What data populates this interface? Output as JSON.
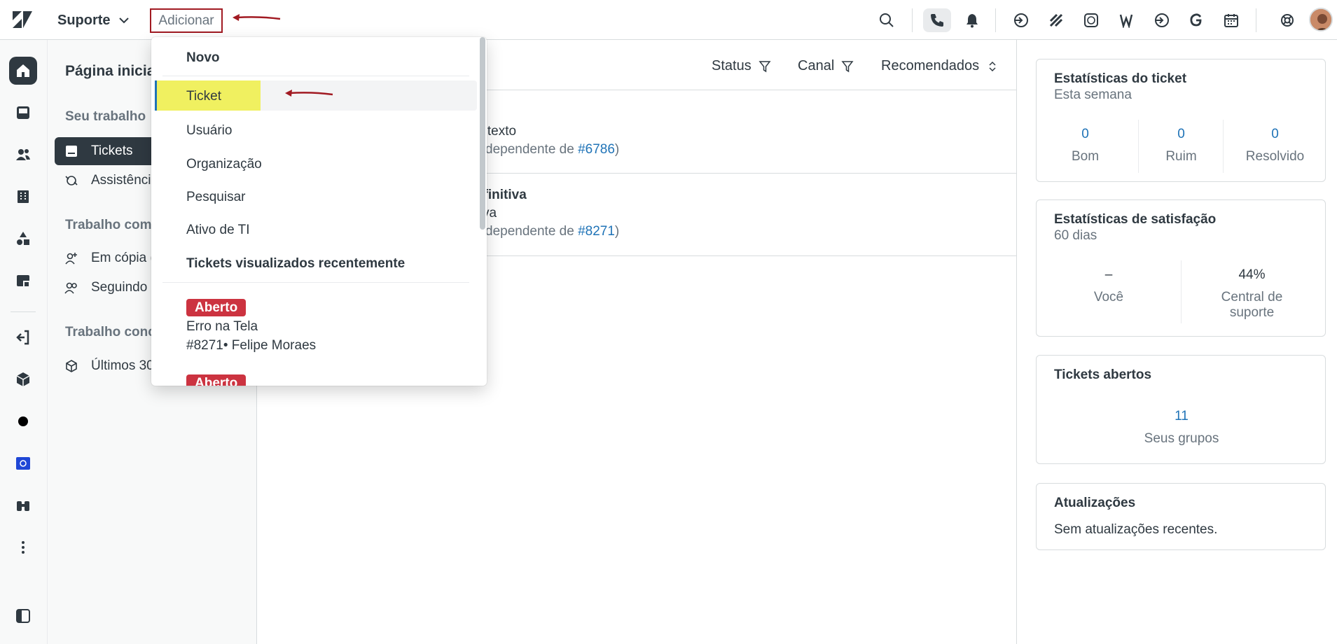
{
  "topbar": {
    "product": "Suporte",
    "add_label": "Adicionar",
    "icons": [
      "search-icon",
      "phone-icon",
      "bell-icon",
      "sign-in-icon",
      "grid-icon",
      "whatsapp-icon",
      "w-icon",
      "sign-in-icon",
      "g-icon",
      "calendar-icon",
      "lifebuoy-icon",
      "avatar"
    ]
  },
  "rail": {
    "icons": [
      "home-icon",
      "inbox-icon",
      "users-icon",
      "building-icon",
      "shapes-icon",
      "report-icon",
      "exit-icon",
      "cube-icon",
      "dot-icon",
      "app-icon",
      "binoculars-icon",
      "more-icon",
      "panel-icon"
    ]
  },
  "nav": {
    "title": "Página inicial",
    "section_your_work": "Seu trabalho",
    "item_tickets": "Tickets",
    "item_assist": "Assistência",
    "section_shared": "Trabalho com",
    "item_cc": "Em cópia (",
    "item_following": "Seguindo",
    "section_done": "Trabalho conc",
    "item_last30": "Últimos 30"
  },
  "center": {
    "filters": {
      "status": "Status",
      "channel": "Canal",
      "sort": "Recomendados"
    },
    "rows": [
      {
        "line1": "' texto",
        "line2_prefix": "dependente de ",
        "line2_link": "#6786",
        "line2_suffix": ")"
      },
      {
        "title": "efinitiva",
        "line1": "va",
        "line2_prefix": "dependente de ",
        "line2_link": "#8271",
        "line2_suffix": ")"
      }
    ]
  },
  "right": {
    "ticket_stats": {
      "title": "Estatísticas do ticket",
      "subtitle": "Esta semana",
      "good_val": "0",
      "good_lbl": "Bom",
      "bad_val": "0",
      "bad_lbl": "Ruim",
      "solved_val": "0",
      "solved_lbl": "Resolvido"
    },
    "satisfaction": {
      "title": "Estatísticas de satisfação",
      "subtitle": "60 dias",
      "you_val": "–",
      "you_lbl": "Você",
      "center_val": "44%",
      "center_lbl": "Central de suporte"
    },
    "open_tickets": {
      "title": "Tickets abertos",
      "val": "11",
      "lbl": "Seus grupos"
    },
    "updates": {
      "title": "Atualizações",
      "text": "Sem atualizações recentes."
    }
  },
  "dropdown": {
    "new_header": "Novo",
    "items": [
      "Ticket",
      "Usuário",
      "Organização",
      "Pesquisar",
      "Ativo de TI"
    ],
    "recent_header": "Tickets visualizados recentemente",
    "recent": [
      {
        "status": "Aberto",
        "title": "Erro na Tela",
        "meta": "#8271• Felipe Moraes"
      },
      {
        "status": "Aberto"
      }
    ]
  },
  "colors": {
    "highlight": "#f0f060",
    "active_nav": "#2f3941",
    "badge_red": "#cc3340",
    "link_blue": "#1f73b7",
    "annotation_arrow": "#a11a22"
  }
}
